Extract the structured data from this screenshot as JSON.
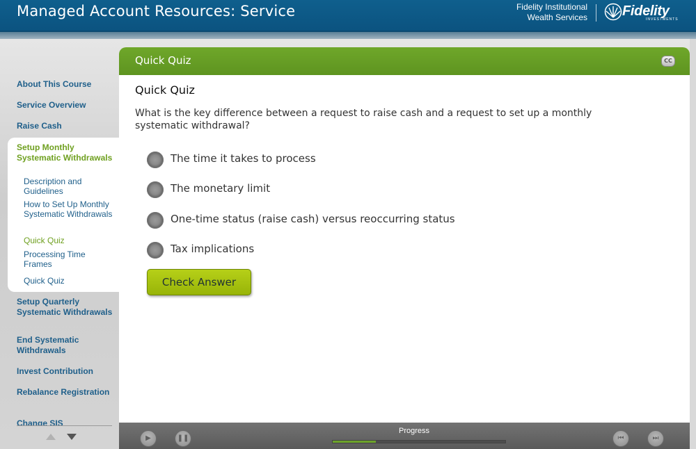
{
  "header": {
    "title": "Managed Account Resources: Service",
    "institution_line1": "Fidelity Institutional",
    "institution_line2": "Wealth Services",
    "logo_text": "Fidelity",
    "logo_sub": "INVESTMENTS"
  },
  "sidebar": {
    "items_top": [
      {
        "label": "About This Course"
      },
      {
        "label": "Service Overview"
      },
      {
        "label": "Raise Cash"
      }
    ],
    "active_section": {
      "label": "Setup Monthly Systematic Withdrawals",
      "subitems": [
        {
          "label": "Description and Guidelines"
        },
        {
          "label": "How to Set Up Monthly Systematic Withdrawals"
        },
        {
          "label": "Quick Quiz",
          "current": true
        },
        {
          "label": "Processing Time Frames"
        },
        {
          "label": "Quick Quiz"
        }
      ]
    },
    "items_bottom": [
      {
        "label": "Setup Quarterly Systematic Withdrawals"
      },
      {
        "label": "End Systematic Withdrawals"
      },
      {
        "label": "Invest Contribution"
      },
      {
        "label": "Rebalance Registration"
      },
      {
        "label": "Change SIS"
      }
    ]
  },
  "content": {
    "bar_title": "Quick Quiz",
    "cc_label": "CC",
    "quiz_title": "Quick Quiz",
    "question": "What is the key difference between a request to raise cash and a request to set up a monthly systematic withdrawal?",
    "options": [
      {
        "label": "The time it takes to process"
      },
      {
        "label": "The monetary limit"
      },
      {
        "label": "One-time status (raise cash) versus reoccurring status"
      },
      {
        "label": "Tax implications"
      }
    ],
    "check_button": "Check Answer"
  },
  "footer": {
    "progress_label": "Progress",
    "progress_fraction": 0.25
  },
  "colors": {
    "header_blue": "#0f5f8d",
    "accent_green": "#6fa72a",
    "nav_blue": "#1f5f8a",
    "active_green": "#6fa020",
    "button_lime": "#b6d018"
  }
}
